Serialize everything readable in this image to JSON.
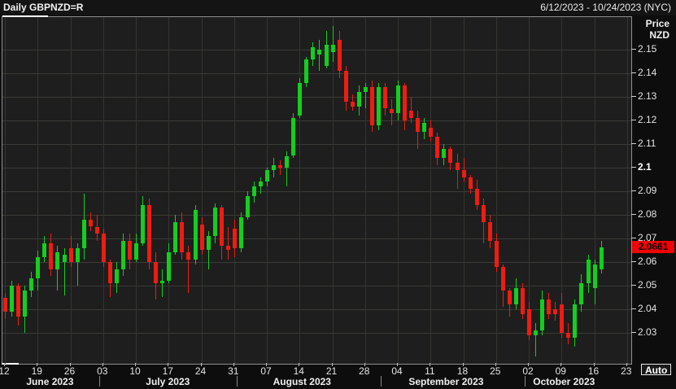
{
  "header": {
    "title": "Daily GBPNZD=R",
    "date_range": "6/12/2023 - 10/24/2023 (NYC)"
  },
  "y_axis": {
    "title": "Price\nNZD",
    "last_price": "2.0661",
    "ticks": [
      {
        "label": "2.15",
        "value": 2.15
      },
      {
        "label": "2.14",
        "value": 2.14
      },
      {
        "label": "2.13",
        "value": 2.13
      },
      {
        "label": "2.12",
        "value": 2.12
      },
      {
        "label": "2.11",
        "value": 2.11
      },
      {
        "label": "2.1",
        "value": 2.1,
        "bold": true
      },
      {
        "label": "2.09",
        "value": 2.09
      },
      {
        "label": "2.08",
        "value": 2.08
      },
      {
        "label": "2.07",
        "value": 2.07
      },
      {
        "label": "2.06",
        "value": 2.06
      },
      {
        "label": "2.05",
        "value": 2.05
      },
      {
        "label": "2.04",
        "value": 2.04
      },
      {
        "label": "2.03",
        "value": 2.03
      }
    ],
    "auto_label": "Auto"
  },
  "x_axis": {
    "ticks": [
      {
        "label": "12",
        "i": 0
      },
      {
        "label": "19",
        "i": 5
      },
      {
        "label": "26",
        "i": 10
      },
      {
        "label": "03",
        "i": 15
      },
      {
        "label": "10",
        "i": 20
      },
      {
        "label": "17",
        "i": 25
      },
      {
        "label": "24",
        "i": 30
      },
      {
        "label": "31",
        "i": 35
      },
      {
        "label": "07",
        "i": 40
      },
      {
        "label": "14",
        "i": 45
      },
      {
        "label": "21",
        "i": 50
      },
      {
        "label": "28",
        "i": 55
      },
      {
        "label": "04",
        "i": 60
      },
      {
        "label": "11",
        "i": 65
      },
      {
        "label": "18",
        "i": 70
      },
      {
        "label": "25",
        "i": 75
      },
      {
        "label": "02",
        "i": 80
      },
      {
        "label": "09",
        "i": 85
      },
      {
        "label": "16",
        "i": 90
      },
      {
        "label": "23",
        "i": 95
      }
    ],
    "months": [
      {
        "label": "June 2023",
        "i": 7
      },
      {
        "label": "July 2023",
        "i": 25
      },
      {
        "label": "August 2023",
        "i": 45.5
      },
      {
        "label": "September 2023",
        "i": 67.5
      },
      {
        "label": "October 2023",
        "i": 85.5
      }
    ],
    "separators": [
      14.5,
      35.5,
      57.5,
      79.5
    ]
  },
  "colors": {
    "up": "#12cf1d",
    "down": "#ee1c11",
    "badge_bg": "#f40000",
    "grid": "#3a3a36"
  },
  "chart_data": {
    "type": "candlestick",
    "symbol": "GBPNZD=R",
    "interval": "Daily",
    "title": "Daily GBPNZD=R",
    "ylabel": "Price NZD",
    "ylim": [
      2.0169,
      2.1638
    ],
    "last_price": 2.0661,
    "columns": [
      "date",
      "open",
      "high",
      "low",
      "close"
    ],
    "candles": [
      [
        "2023-06-12",
        2.045,
        2.047,
        2.036,
        2.039
      ],
      [
        "2023-06-13",
        2.039,
        2.052,
        2.037,
        2.05
      ],
      [
        "2023-06-14",
        2.05,
        2.051,
        2.033,
        2.037
      ],
      [
        "2023-06-15",
        2.037,
        2.05,
        2.03,
        2.048
      ],
      [
        "2023-06-16",
        2.048,
        2.056,
        2.045,
        2.053
      ],
      [
        "2023-06-19",
        2.053,
        2.065,
        2.048,
        2.062
      ],
      [
        "2023-06-20",
        2.062,
        2.071,
        2.06,
        2.068
      ],
      [
        "2023-06-21",
        2.068,
        2.072,
        2.054,
        2.057
      ],
      [
        "2023-06-22",
        2.057,
        2.067,
        2.048,
        2.064
      ],
      [
        "2023-06-23",
        2.06,
        2.066,
        2.046,
        2.063
      ],
      [
        "2023-06-26",
        2.066,
        2.071,
        2.058,
        2.06
      ],
      [
        "2023-06-27",
        2.06,
        2.068,
        2.05,
        2.066
      ],
      [
        "2023-06-28",
        2.066,
        2.089,
        2.061,
        2.078
      ],
      [
        "2023-06-29",
        2.078,
        2.081,
        2.073,
        2.075
      ],
      [
        "2023-06-30",
        2.075,
        2.08,
        2.069,
        2.072
      ],
      [
        "2023-07-03",
        2.072,
        2.074,
        2.058,
        2.06
      ],
      [
        "2023-07-04",
        2.06,
        2.061,
        2.045,
        2.051
      ],
      [
        "2023-07-05",
        2.051,
        2.06,
        2.047,
        2.057
      ],
      [
        "2023-07-06",
        2.057,
        2.072,
        2.054,
        2.069
      ],
      [
        "2023-07-07",
        2.069,
        2.072,
        2.057,
        2.061
      ],
      [
        "2023-07-10",
        2.061,
        2.072,
        2.06,
        2.068
      ],
      [
        "2023-07-11",
        2.068,
        2.088,
        2.067,
        2.084
      ],
      [
        "2023-07-12",
        2.084,
        2.087,
        2.057,
        2.06
      ],
      [
        "2023-07-13",
        2.06,
        2.064,
        2.044,
        2.051
      ],
      [
        "2023-07-14",
        2.051,
        2.057,
        2.045,
        2.052
      ],
      [
        "2023-07-17",
        2.052,
        2.068,
        2.051,
        2.064
      ],
      [
        "2023-07-18",
        2.064,
        2.08,
        2.063,
        2.077
      ],
      [
        "2023-07-19",
        2.077,
        2.081,
        2.061,
        2.064
      ],
      [
        "2023-07-20",
        2.064,
        2.067,
        2.047,
        2.061
      ],
      [
        "2023-07-21",
        2.061,
        2.084,
        2.059,
        2.082
      ],
      [
        "2023-07-24",
        2.076,
        2.079,
        2.063,
        2.065
      ],
      [
        "2023-07-25",
        2.065,
        2.073,
        2.057,
        2.071
      ],
      [
        "2023-07-26",
        2.071,
        2.085,
        2.068,
        2.083
      ],
      [
        "2023-07-27",
        2.083,
        2.084,
        2.061,
        2.067
      ],
      [
        "2023-07-28",
        2.067,
        2.075,
        2.061,
        2.065
      ],
      [
        "2023-07-31",
        2.074,
        2.078,
        2.062,
        2.066
      ],
      [
        "2023-08-01",
        2.066,
        2.081,
        2.064,
        2.079
      ],
      [
        "2023-08-02",
        2.079,
        2.09,
        2.078,
        2.088
      ],
      [
        "2023-08-03",
        2.088,
        2.094,
        2.085,
        2.092
      ],
      [
        "2023-08-04",
        2.092,
        2.096,
        2.089,
        2.094
      ],
      [
        "2023-08-07",
        2.094,
        2.1,
        2.092,
        2.099
      ],
      [
        "2023-08-08",
        2.099,
        2.104,
        2.096,
        2.101
      ],
      [
        "2023-08-09",
        2.101,
        2.103,
        2.097,
        2.1
      ],
      [
        "2023-08-10",
        2.1,
        2.107,
        2.092,
        2.105
      ],
      [
        "2023-08-11",
        2.105,
        2.123,
        2.104,
        2.121
      ],
      [
        "2023-08-14",
        2.122,
        2.138,
        2.121,
        2.136
      ],
      [
        "2023-08-15",
        2.136,
        2.147,
        2.134,
        2.146
      ],
      [
        "2023-08-16",
        2.146,
        2.153,
        2.143,
        2.151
      ],
      [
        "2023-08-17",
        2.148,
        2.154,
        2.141,
        2.15
      ],
      [
        "2023-08-18",
        2.143,
        2.158,
        2.142,
        2.152
      ],
      [
        "2023-08-21",
        2.149,
        2.16,
        2.145,
        2.152
      ],
      [
        "2023-08-22",
        2.154,
        2.158,
        2.138,
        2.141
      ],
      [
        "2023-08-23",
        2.141,
        2.143,
        2.124,
        2.128
      ],
      [
        "2023-08-24",
        2.128,
        2.131,
        2.124,
        2.126
      ],
      [
        "2023-08-25",
        2.126,
        2.135,
        2.122,
        2.132
      ],
      [
        "2023-08-28",
        2.132,
        2.136,
        2.125,
        2.134
      ],
      [
        "2023-08-29",
        2.134,
        2.137,
        2.115,
        2.118
      ],
      [
        "2023-08-30",
        2.118,
        2.136,
        2.116,
        2.134
      ],
      [
        "2023-08-31",
        2.134,
        2.136,
        2.122,
        2.125
      ],
      [
        "2023-09-01",
        2.125,
        2.129,
        2.118,
        2.123
      ],
      [
        "2023-09-04",
        2.123,
        2.137,
        2.12,
        2.135
      ],
      [
        "2023-09-05",
        2.135,
        2.136,
        2.116,
        2.12
      ],
      [
        "2023-09-06",
        2.124,
        2.13,
        2.119,
        2.121
      ],
      [
        "2023-09-07",
        2.121,
        2.124,
        2.108,
        2.115
      ],
      [
        "2023-09-08",
        2.115,
        2.121,
        2.112,
        2.119
      ],
      [
        "2023-09-11",
        2.117,
        2.12,
        2.111,
        2.113
      ],
      [
        "2023-09-12",
        2.113,
        2.115,
        2.101,
        2.104
      ],
      [
        "2023-09-13",
        2.104,
        2.11,
        2.101,
        2.108
      ],
      [
        "2023-09-14",
        2.108,
        2.109,
        2.099,
        2.102
      ],
      [
        "2023-09-15",
        2.102,
        2.106,
        2.091,
        2.099
      ],
      [
        "2023-09-18",
        2.099,
        2.104,
        2.094,
        2.096
      ],
      [
        "2023-09-19",
        2.096,
        2.097,
        2.089,
        2.091
      ],
      [
        "2023-09-20",
        2.091,
        2.095,
        2.082,
        2.084
      ],
      [
        "2023-09-21",
        2.084,
        2.087,
        2.068,
        2.077
      ],
      [
        "2023-09-22",
        2.077,
        2.08,
        2.066,
        2.069
      ],
      [
        "2023-09-25",
        2.069,
        2.072,
        2.056,
        2.058
      ],
      [
        "2023-09-26",
        2.058,
        2.059,
        2.041,
        2.048
      ],
      [
        "2023-09-27",
        2.048,
        2.049,
        2.037,
        2.042
      ],
      [
        "2023-09-28",
        2.042,
        2.053,
        2.04,
        2.049
      ],
      [
        "2023-09-29",
        2.049,
        2.051,
        2.036,
        2.038
      ],
      [
        "2023-10-02",
        2.04,
        2.043,
        2.027,
        2.029
      ],
      [
        "2023-10-03",
        2.029,
        2.034,
        2.02,
        2.031
      ],
      [
        "2023-10-04",
        2.031,
        2.048,
        2.029,
        2.044
      ],
      [
        "2023-10-05",
        2.044,
        2.047,
        2.036,
        2.038
      ],
      [
        "2023-10-06",
        2.04,
        2.043,
        2.035,
        2.038
      ],
      [
        "2023-10-09",
        2.042,
        2.047,
        2.028,
        2.03
      ],
      [
        "2023-10-10",
        2.03,
        2.034,
        2.025,
        2.028
      ],
      [
        "2023-10-11",
        2.028,
        2.044,
        2.024,
        2.042
      ],
      [
        "2023-10-12",
        2.042,
        2.055,
        2.039,
        2.051
      ],
      [
        "2023-10-13",
        2.051,
        2.063,
        2.047,
        2.061
      ],
      [
        "2023-10-16",
        2.049,
        2.061,
        2.042,
        2.059
      ],
      [
        "2023-10-17",
        2.057,
        2.069,
        2.055,
        2.0661
      ]
    ]
  }
}
